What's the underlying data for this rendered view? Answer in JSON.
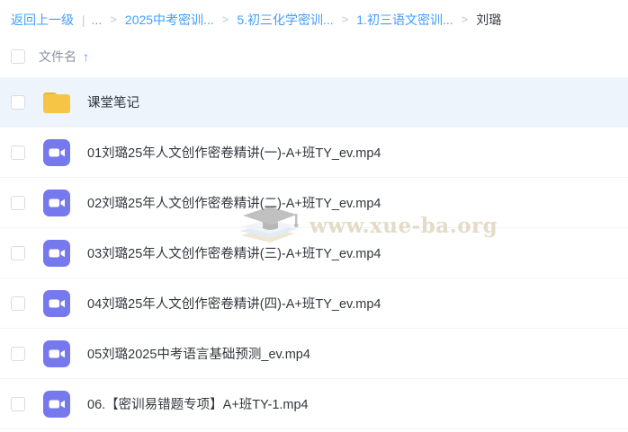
{
  "breadcrumb": {
    "back_label": "返回上一级",
    "pipe": "|",
    "ellipsis": "...",
    "separator": ">",
    "items": [
      {
        "label": "2025中考密训...",
        "link": true
      },
      {
        "label": "5.初三化学密训...",
        "link": true
      },
      {
        "label": "1.初三语文密训...",
        "link": true
      },
      {
        "label": "刘璐",
        "link": false
      }
    ]
  },
  "table": {
    "header": {
      "filename_label": "文件名",
      "sort_arrow": "↑"
    }
  },
  "files": [
    {
      "name": "课堂笔记",
      "type": "folder",
      "highlighted": true
    },
    {
      "name": "01刘璐25年人文创作密卷精讲(一)-A+班TY_ev.mp4",
      "type": "video",
      "highlighted": false
    },
    {
      "name": "02刘璐25年人文创作密卷精讲(二)-A+班TY_ev.mp4",
      "type": "video",
      "highlighted": false
    },
    {
      "name": "03刘璐25年人文创作密卷精讲(三)-A+班TY_ev.mp4",
      "type": "video",
      "highlighted": false
    },
    {
      "name": "04刘璐25年人文创作密卷精讲(四)-A+班TY_ev.mp4",
      "type": "video",
      "highlighted": false
    },
    {
      "name": "05刘璐2025中考语言基础预测_ev.mp4",
      "type": "video",
      "highlighted": false
    },
    {
      "name": "06.【密训易错题专项】A+班TY-1.mp4",
      "type": "video",
      "highlighted": false
    }
  ],
  "watermark": {
    "text": "www.xue-ba.org"
  },
  "icons": {
    "folder": "folder-icon",
    "video": "video-file-icon",
    "sort": "sort-ascending-icon",
    "watermark": "graduation-cap-icon"
  },
  "colors": {
    "link_blue": "#409eff",
    "folder_yellow": "#f6c545",
    "folder_tab_yellow": "#eab83a",
    "video_purple": "#7678ee",
    "selected_row_bg": "#edf4fb",
    "header_text": "#8d939c",
    "file_text": "#33373d",
    "divider": "#f2f4f7",
    "watermark_tan": "#d5c7a4"
  }
}
